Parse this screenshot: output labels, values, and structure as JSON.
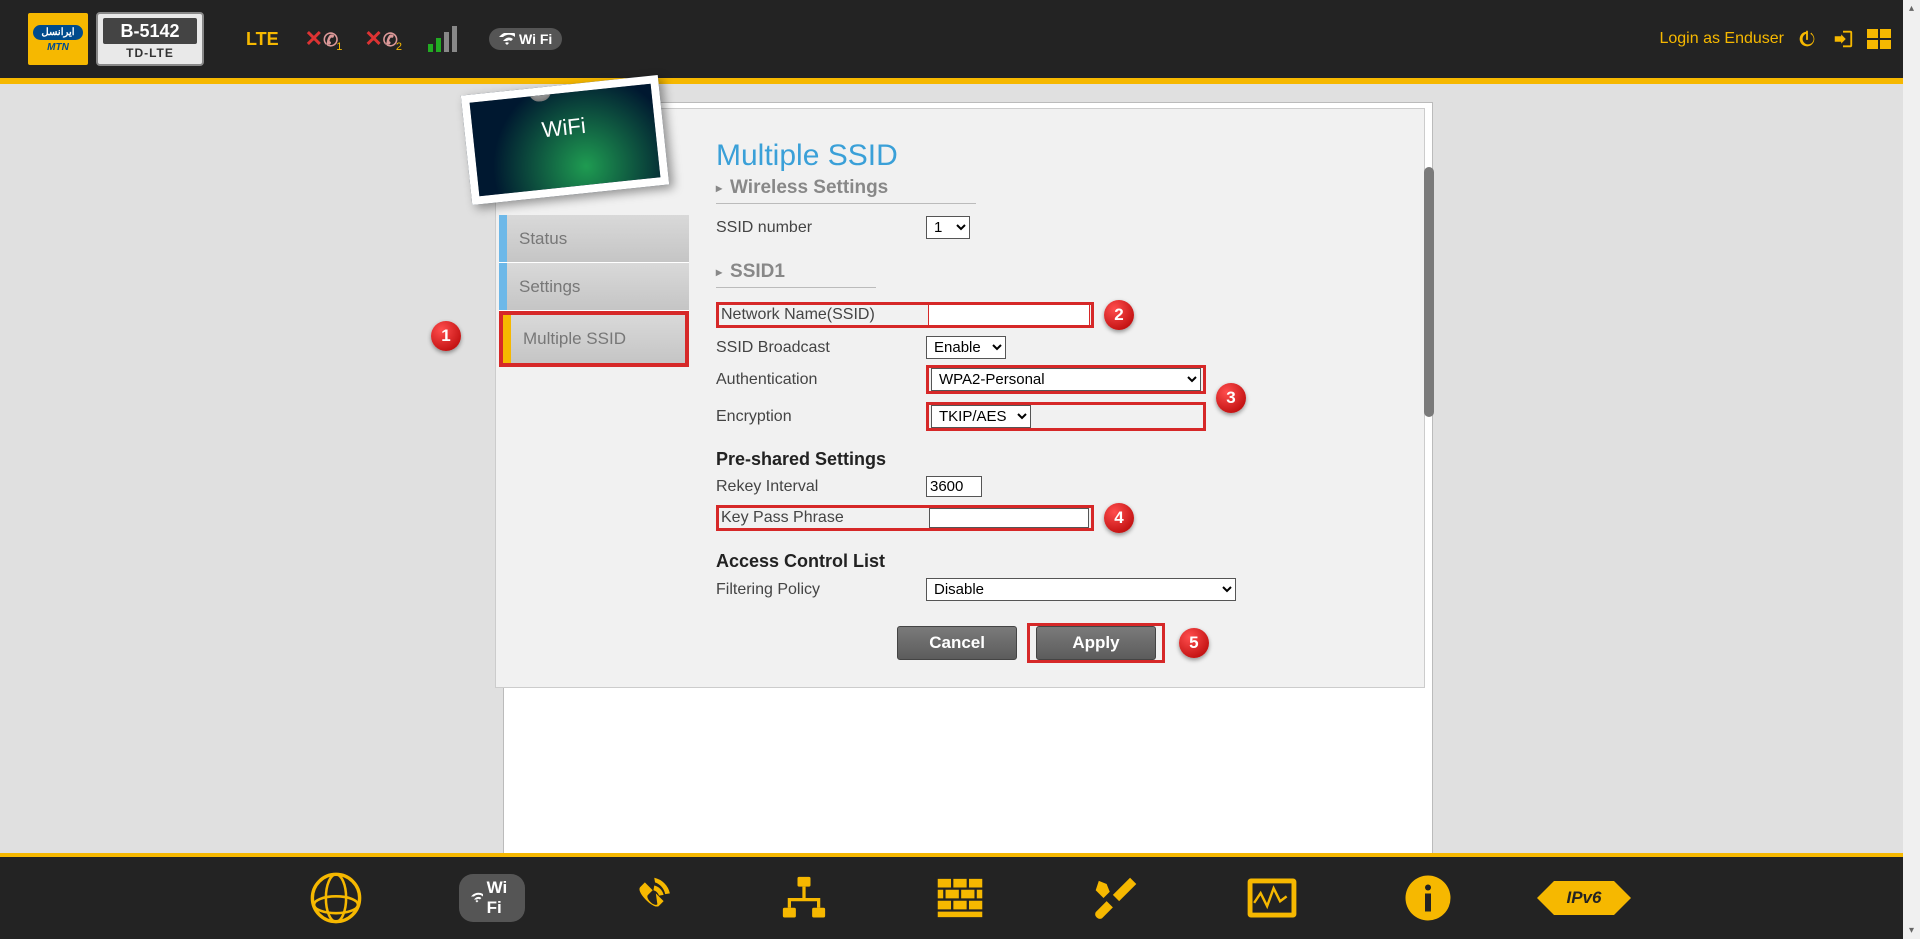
{
  "header": {
    "model_top": "B-5142",
    "model_bot": "TD-LTE",
    "brand_oval": "ایرانسل",
    "brand_txt": "MTN",
    "lte": "LTE",
    "call1_sub": "1",
    "call2_sub": "2",
    "wifi_pill": "Wi Fi",
    "login_link": "Login as Enduser"
  },
  "tile": {
    "label": "WiFi"
  },
  "nav": {
    "items": [
      {
        "label": "Status",
        "active": false
      },
      {
        "label": "Settings",
        "active": false
      },
      {
        "label": "Multiple SSID",
        "active": true
      }
    ]
  },
  "page": {
    "title": "Multiple SSID",
    "wireless_settings": "Wireless Settings",
    "ssid_number_label": "SSID number",
    "ssid_number_value": "1",
    "ssid1_header": "SSID1",
    "network_name_label": "Network Name(SSID)",
    "network_name_value": "",
    "ssid_broadcast_label": "SSID Broadcast",
    "ssid_broadcast_value": "Enable",
    "auth_label": "Authentication",
    "auth_value": "WPA2-Personal",
    "enc_label": "Encryption",
    "enc_value": "TKIP/AES",
    "psk_header": "Pre-shared Settings",
    "rekey_label": "Rekey Interval",
    "rekey_value": "3600",
    "keyphrase_label": "Key Pass Phrase",
    "keyphrase_value": "",
    "acl_header": "Access Control List",
    "filter_label": "Filtering Policy",
    "filter_value": "Disable",
    "cancel": "Cancel",
    "apply": "Apply"
  },
  "callouts": {
    "c1": "1",
    "c2": "2",
    "c3": "3",
    "c4": "4",
    "c5": "5"
  },
  "bottom": {
    "wifi_pill": "Wi Fi",
    "ipv6": "IPv6"
  }
}
